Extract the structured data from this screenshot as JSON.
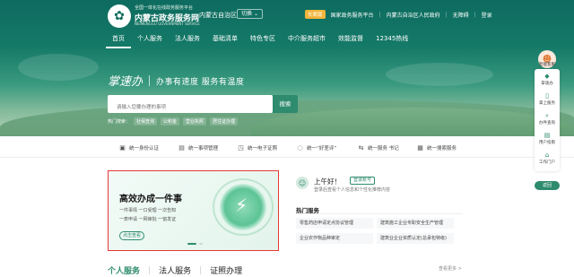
{
  "header": {
    "brand_small": "全国一体化在线政务服务平台",
    "brand": "内蒙古政务服务网",
    "brand_en": "NEIMENGGU GOVERNMENT SERVICE",
    "region": "内蒙古自治区",
    "switch_label": "切换",
    "badge": "长辈版",
    "links": [
      "国家政务服务平台",
      "内蒙古自治区人民政府",
      "无障碍",
      "登录"
    ]
  },
  "nav": [
    "首页",
    "个人服务",
    "法人服务",
    "基础清单",
    "特色专区",
    "中介服务超市",
    "效能监督",
    "12345热线"
  ],
  "hero": {
    "calligraphy": "掌速办",
    "slogan": "办事有速度 服务有温度",
    "search_placeholder": "请输入您要办理的事项",
    "search_button": "搜索",
    "hot_label": "热门搜索：",
    "hot_tags": [
      "社保查询",
      "公积金",
      "营业执照",
      "居住证办理"
    ]
  },
  "quick_links": [
    {
      "icon": "user-card-icon",
      "label": "统一身份认证"
    },
    {
      "icon": "document-icon",
      "label": "统一事项管理"
    },
    {
      "icon": "certificate-icon",
      "label": "统一电子证照"
    },
    {
      "icon": "chat-icon",
      "label": "统一“好差评”"
    },
    {
      "icon": "flow-icon",
      "label": "统一服务 书记"
    },
    {
      "icon": "grid-icon",
      "label": "统一搜索服务"
    }
  ],
  "feature": {
    "title": "高效办成一件事",
    "line1": "一件事情 一口受理 一次告知",
    "line2": "一表申请 一网审批 一窗发证",
    "button": "点击查看"
  },
  "user": {
    "greeting": "上午好！",
    "login_button": "登录账号",
    "subtitle": "登录后查看个人信息和个性化推荐内容",
    "hot_services_title": "热门服务",
    "hot_services": [
      "零售药店申请定点协议管理",
      "建筑施工企业专职安全生产管理",
      "企业农作物品种审定",
      "建筑业企业资质认定(总承包特级)"
    ]
  },
  "bottom_tabs": [
    "个人服务",
    "法人服务",
    "证照办理"
  ],
  "bottom_more": "查看更多 >",
  "sidebar": {
    "assistant_label": "智能客服",
    "items": [
      "掌速办",
      "掌上服务",
      "办件查询",
      "用户指南",
      "工作门户"
    ],
    "top_button": "返回"
  },
  "colors": {
    "brand_green": "#2e8b6e",
    "hero_dark": "#0d6b5f",
    "highlight_border": "#e53935",
    "badge": "#f2b43a"
  }
}
